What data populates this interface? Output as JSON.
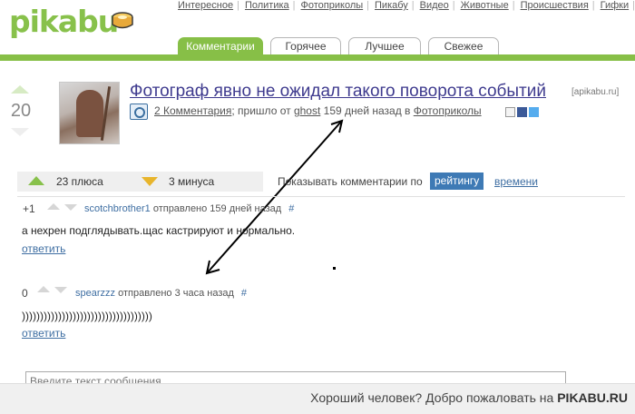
{
  "header": {
    "logo": "pikabu",
    "nav": [
      "Интересное",
      "Политика",
      "Фотоприколы",
      "Пикабу",
      "Видео",
      "Животные",
      "Происшествия",
      "Гифки"
    ],
    "tabs": [
      "Комментарии",
      "Горячее",
      "Лучшее",
      "Свежее"
    ],
    "active_tab": "Комментарии",
    "accent_color": "#87bf47"
  },
  "post": {
    "rating": "20",
    "title": "Фотограф явно не ожидал такого поворота событий",
    "source": "[apikabu.ru]",
    "comments_link": "2 Комментария",
    "meta_sent": "; пришло от ",
    "author": "ghost",
    "age_num": "159",
    "age_rest": " дней назад в ",
    "category": "Фотоприколы",
    "share_icons": [
      "save-icon",
      "facebook-icon",
      "twitter-icon"
    ]
  },
  "rating_bar": {
    "plus": "23 плюса",
    "minus": "3 минуса",
    "sort_label": "Показывать комментарии по",
    "sort_active": "рейтингу",
    "sort_other": "времени"
  },
  "comments": [
    {
      "score": "+1",
      "user": "scotchbrother1",
      "sent": " отправлено 159 дней назад",
      "hash": "#",
      "text": "а нехрен подглядывать.щас кастрируют и нормально.",
      "reply": "ответить"
    },
    {
      "score": "0",
      "user": "spearzzz",
      "sent": " отправлено 3 часа назад",
      "hash": "#",
      "text": "))))))))))))))))))))))))))))))))))))",
      "reply": "ответить"
    }
  ],
  "input": {
    "placeholder": "Введите текст сообщения"
  },
  "footer": {
    "text": "Хороший человек? Добро пожаловать на ",
    "brand": "PIKABU.RU"
  }
}
